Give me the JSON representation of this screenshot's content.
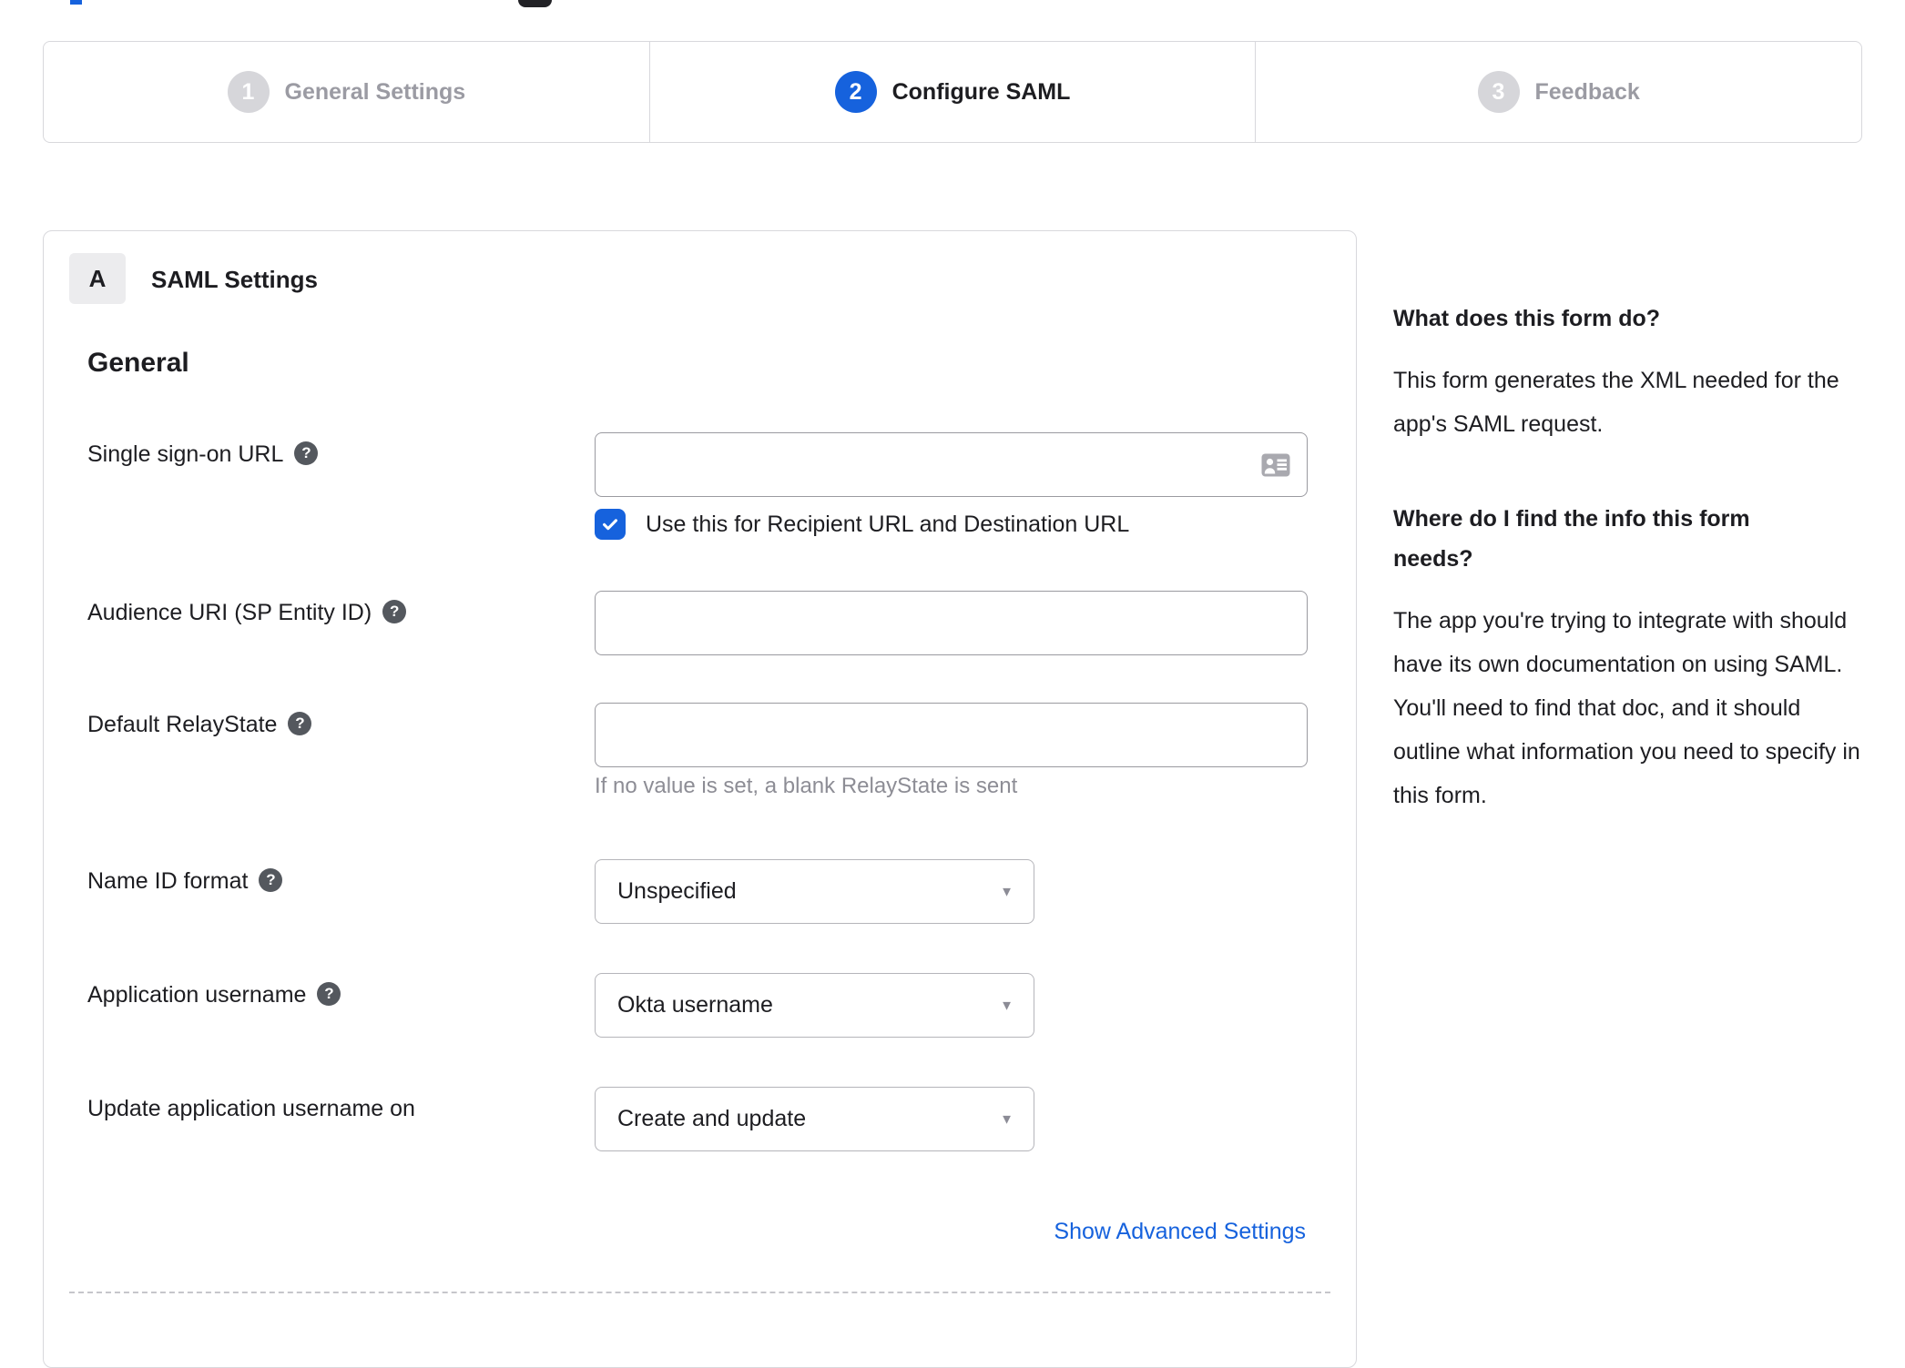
{
  "fragments": {},
  "stepper": {
    "steps": [
      {
        "number": "1",
        "label": "General Settings"
      },
      {
        "number": "2",
        "label": "Configure SAML"
      },
      {
        "number": "3",
        "label": "Feedback"
      }
    ]
  },
  "panel": {
    "badge": "A",
    "title": "SAML Settings",
    "subsection": "General",
    "advanced_link": "Show Advanced Settings"
  },
  "form": {
    "sso_url": {
      "label": "Single sign-on URL",
      "value": "",
      "checkbox_label": "Use this for Recipient URL and Destination URL",
      "checkbox_checked": true
    },
    "audience_uri": {
      "label": "Audience URI (SP Entity ID)",
      "value": ""
    },
    "default_relay_state": {
      "label": "Default RelayState",
      "value": "",
      "hint": "If no value is set, a blank RelayState is sent"
    },
    "name_id_format": {
      "label": "Name ID format",
      "value": "Unspecified"
    },
    "application_username": {
      "label": "Application username",
      "value": "Okta username"
    },
    "update_application_username": {
      "label": "Update application username on",
      "value": "Create and update"
    }
  },
  "sidebar": {
    "section1": {
      "heading": "What does this form do?",
      "body": "This form generates the XML needed for the app's SAML request."
    },
    "section2": {
      "heading": "Where do I find the info this form needs?",
      "body": "The app you're trying to integrate with should have its own documentation on using SAML. You'll need to find that doc, and it should outline what information you need to specify in this form."
    }
  },
  "icons": {
    "help_glyph": "?",
    "caret_glyph": "▼"
  },
  "colors": {
    "accent": "#1662dd",
    "inactive_gray": "#9b9ba3",
    "hint_gray": "#8d8d95"
  }
}
